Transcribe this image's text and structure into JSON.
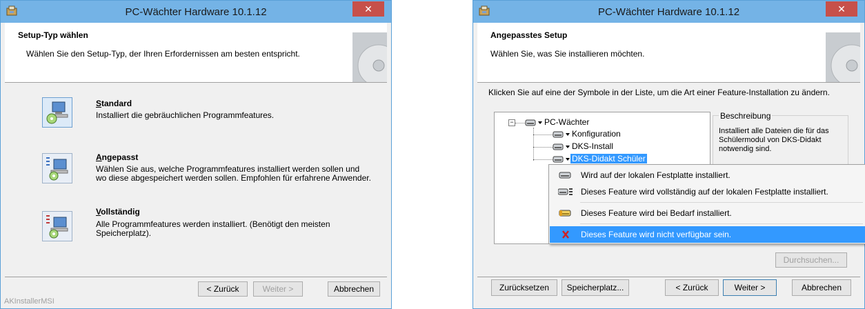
{
  "window1": {
    "title": "PC-Wächter Hardware 10.1.12",
    "close_label": "✕",
    "header_title": "Setup-Typ wählen",
    "header_subtitle": "Wählen Sie den Setup-Typ, der Ihren Erfordernissen am besten entspricht.",
    "options": [
      {
        "title_first": "S",
        "title_rest": "tandard",
        "desc": "Installiert die gebräuchlichen Programmfeatures."
      },
      {
        "title_first": "A",
        "title_rest": "ngepasst",
        "desc": "Wählen Sie aus, welche Programmfeatures installiert werden sollen und wo diese abgespeichert werden sollen. Empfohlen für erfahrene Anwender."
      },
      {
        "title_first": "V",
        "title_rest": "ollständig",
        "desc": "Alle Programmfeatures werden installiert. (Benötigt den meisten Speicherplatz)."
      }
    ],
    "buttons": {
      "back": "< Zurück",
      "next": "Weiter >",
      "cancel": "Abbrechen"
    },
    "watermark": "AKInstallerMSI"
  },
  "window2": {
    "title": "PC-Wächter Hardware 10.1.12",
    "close_label": "✕",
    "header_title": "Angepasstes Setup",
    "header_subtitle": "Wählen Sie, was Sie installieren möchten.",
    "instruction": "Klicken Sie auf eine der Symbole in der Liste, um die Art einer Feature-Installation zu ändern.",
    "tree": {
      "root": "PC-Wächter",
      "children": [
        "Konfiguration",
        "DKS-Install",
        "DKS-Didakt Schüler"
      ],
      "selected_index": 2
    },
    "description": {
      "legend": "Beschreibung",
      "text": "Installiert alle Dateien die für das Schülermodul von DKS-Didakt notwendig sind."
    },
    "context_menu": [
      {
        "label": "Wird auf der lokalen Festplatte installiert.",
        "icon": "hard-drive-icon"
      },
      {
        "label": "Dieses Feature wird vollständig auf der lokalen Festplatte installiert.",
        "icon": "hard-drive-full-icon"
      },
      {
        "label": "Dieses Feature wird bei Bedarf installiert.",
        "icon": "install-on-demand-icon"
      },
      {
        "label": "Dieses Feature wird nicht verfügbar sein.",
        "icon": "red-x-icon",
        "highlighted": true
      }
    ],
    "buttons": {
      "browse": "Durchsuchen...",
      "reset": "Zurücksetzen",
      "disk_usage": "Speicherplatz...",
      "back": "< Zurück",
      "next": "Weiter >",
      "cancel": "Abbrechen"
    }
  },
  "colors": {
    "titlebar": "#74b3e6",
    "close": "#c7504a",
    "highlight": "#3399ff"
  }
}
